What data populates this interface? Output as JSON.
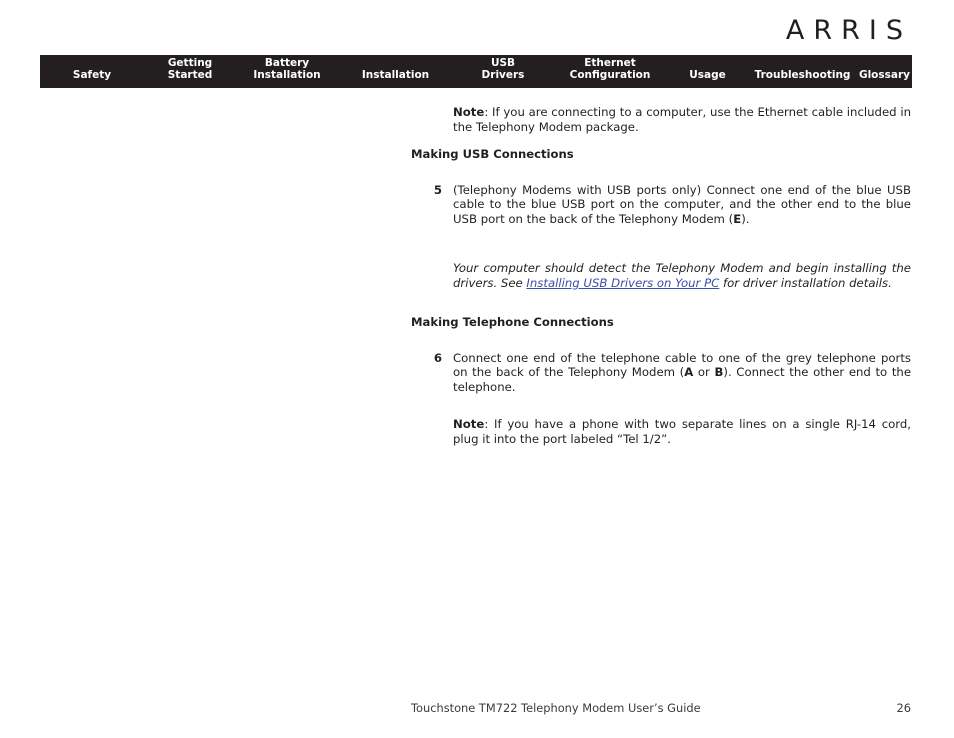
{
  "brand": {
    "logo_text": "ARRIS"
  },
  "nav": {
    "items": [
      {
        "id": "safety",
        "lines": [
          "Safety"
        ]
      },
      {
        "id": "getting-started",
        "lines": [
          "Getting",
          "Started"
        ]
      },
      {
        "id": "battery-installation",
        "lines": [
          "Battery",
          "Installation"
        ]
      },
      {
        "id": "installation",
        "lines": [
          "Installation"
        ]
      },
      {
        "id": "usb-drivers",
        "lines": [
          "USB",
          "Drivers"
        ]
      },
      {
        "id": "ethernet-configuration",
        "lines": [
          "Ethernet",
          "Configuration"
        ]
      },
      {
        "id": "usage",
        "lines": [
          "Usage"
        ]
      },
      {
        "id": "troubleshooting",
        "lines": [
          "Troubleshooting"
        ]
      },
      {
        "id": "glossary",
        "lines": [
          "Glossary"
        ]
      }
    ]
  },
  "content": {
    "note_ethernet": {
      "label": "Note",
      "text": ": If you are connecting to a computer, use the Ethernet cable included in the Telephony Modem package."
    },
    "heading_usb": "Making USB Connections",
    "step5": {
      "number": "5",
      "text_a": "(Telephony Modems with USB ports only) Connect one end of the blue USB cable to the blue USB port on the computer, and the other end to the blue USB port on the back of the Telephony Modem (",
      "bold_ref": "E",
      "text_b": ")."
    },
    "usb_italic": {
      "text_a": "Your computer should detect the Telephony Modem and begin installing the drivers. See ",
      "link_text": "Installing USB Drivers on Your PC",
      "text_b": " for driver installation details."
    },
    "heading_telephone": "Making Telephone Connections",
    "step6": {
      "number": "6",
      "text_a": "Connect one end of the telephone cable to one of the grey telephone ports on the back of the Telephony Modem (",
      "bold_ref_a": "A",
      "text_mid": " or ",
      "bold_ref_b": "B",
      "text_b": "). Connect the other end to the telephone."
    },
    "note_rj14": {
      "label": "Note",
      "text": ": If you have a phone with two separate lines on a single RJ-14 cord, plug it into the port labeled “Tel 1/2”."
    }
  },
  "footer": {
    "title": "Touchstone TM722 Telephony Modem User’s Guide",
    "page": "26"
  },
  "colors": {
    "nav_background": "#231f20",
    "text": "#231f20",
    "link": "#3b4ea8",
    "page_background": "#ffffff"
  }
}
